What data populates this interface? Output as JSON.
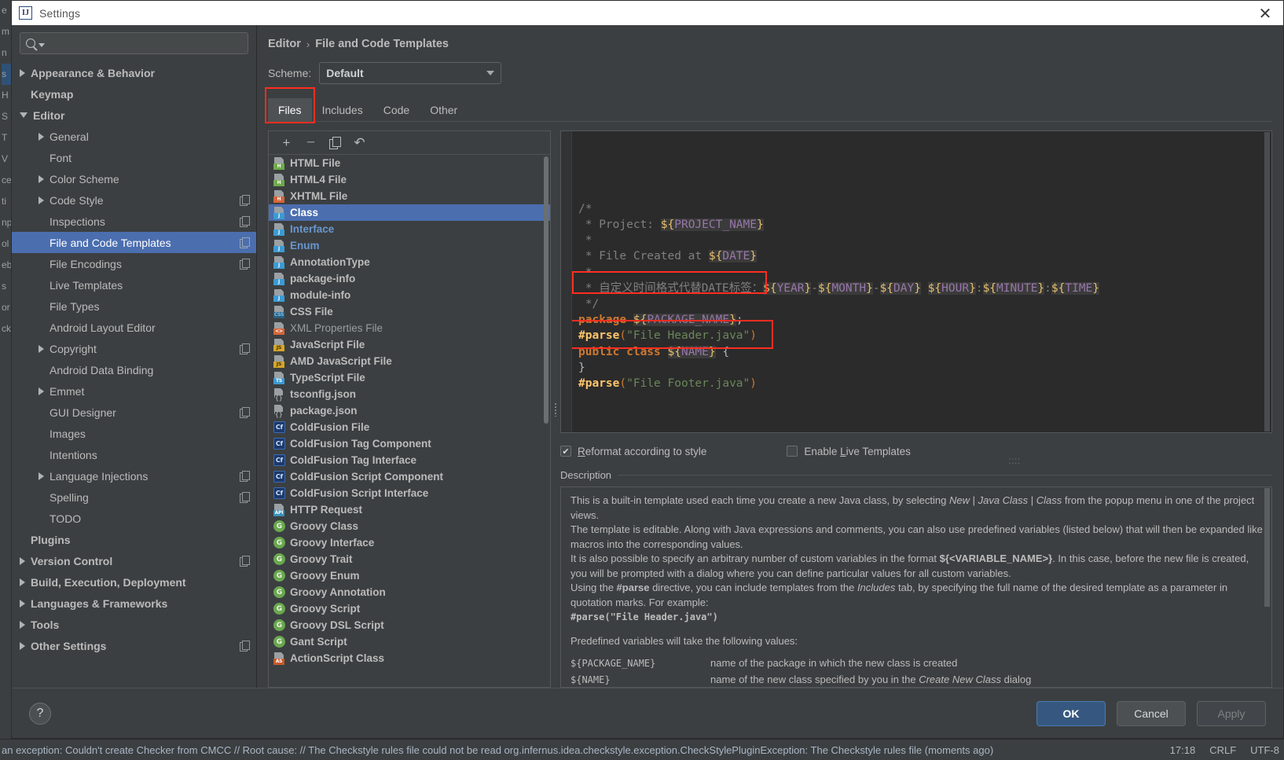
{
  "window": {
    "title": "Settings",
    "logo_text": "IJ",
    "close_label": "✕"
  },
  "search": {
    "value": "",
    "placeholder": ""
  },
  "sidebar": {
    "items": [
      {
        "label": "Appearance & Behavior",
        "arrow": "closed",
        "indent": 0,
        "bold": true,
        "copy": false,
        "selected": false
      },
      {
        "label": "Keymap",
        "arrow": "none",
        "indent": 0,
        "bold": true,
        "copy": false,
        "selected": false
      },
      {
        "label": "Editor",
        "arrow": "open",
        "indent": 0,
        "bold": true,
        "copy": false,
        "selected": false
      },
      {
        "label": "General",
        "arrow": "closed",
        "indent": 1,
        "bold": false,
        "copy": false,
        "selected": false
      },
      {
        "label": "Font",
        "arrow": "none",
        "indent": 1,
        "bold": false,
        "copy": false,
        "selected": false
      },
      {
        "label": "Color Scheme",
        "arrow": "closed",
        "indent": 1,
        "bold": false,
        "copy": false,
        "selected": false
      },
      {
        "label": "Code Style",
        "arrow": "closed",
        "indent": 1,
        "bold": false,
        "copy": true,
        "selected": false
      },
      {
        "label": "Inspections",
        "arrow": "none",
        "indent": 1,
        "bold": false,
        "copy": true,
        "selected": false
      },
      {
        "label": "File and Code Templates",
        "arrow": "none",
        "indent": 1,
        "bold": false,
        "copy": true,
        "selected": true
      },
      {
        "label": "File Encodings",
        "arrow": "none",
        "indent": 1,
        "bold": false,
        "copy": true,
        "selected": false
      },
      {
        "label": "Live Templates",
        "arrow": "none",
        "indent": 1,
        "bold": false,
        "copy": false,
        "selected": false
      },
      {
        "label": "File Types",
        "arrow": "none",
        "indent": 1,
        "bold": false,
        "copy": false,
        "selected": false
      },
      {
        "label": "Android Layout Editor",
        "arrow": "none",
        "indent": 1,
        "bold": false,
        "copy": false,
        "selected": false
      },
      {
        "label": "Copyright",
        "arrow": "closed",
        "indent": 1,
        "bold": false,
        "copy": true,
        "selected": false
      },
      {
        "label": "Android Data Binding",
        "arrow": "none",
        "indent": 1,
        "bold": false,
        "copy": false,
        "selected": false
      },
      {
        "label": "Emmet",
        "arrow": "closed",
        "indent": 1,
        "bold": false,
        "copy": false,
        "selected": false
      },
      {
        "label": "GUI Designer",
        "arrow": "none",
        "indent": 1,
        "bold": false,
        "copy": true,
        "selected": false
      },
      {
        "label": "Images",
        "arrow": "none",
        "indent": 1,
        "bold": false,
        "copy": false,
        "selected": false
      },
      {
        "label": "Intentions",
        "arrow": "none",
        "indent": 1,
        "bold": false,
        "copy": false,
        "selected": false
      },
      {
        "label": "Language Injections",
        "arrow": "closed",
        "indent": 1,
        "bold": false,
        "copy": true,
        "selected": false
      },
      {
        "label": "Spelling",
        "arrow": "none",
        "indent": 1,
        "bold": false,
        "copy": true,
        "selected": false
      },
      {
        "label": "TODO",
        "arrow": "none",
        "indent": 1,
        "bold": false,
        "copy": false,
        "selected": false
      },
      {
        "label": "Plugins",
        "arrow": "none",
        "indent": 0,
        "bold": true,
        "copy": false,
        "selected": false
      },
      {
        "label": "Version Control",
        "arrow": "closed",
        "indent": 0,
        "bold": true,
        "copy": true,
        "selected": false
      },
      {
        "label": "Build, Execution, Deployment",
        "arrow": "closed",
        "indent": 0,
        "bold": true,
        "copy": false,
        "selected": false
      },
      {
        "label": "Languages & Frameworks",
        "arrow": "closed",
        "indent": 0,
        "bold": true,
        "copy": false,
        "selected": false
      },
      {
        "label": "Tools",
        "arrow": "closed",
        "indent": 0,
        "bold": true,
        "copy": false,
        "selected": false
      },
      {
        "label": "Other Settings",
        "arrow": "closed",
        "indent": 0,
        "bold": true,
        "copy": true,
        "selected": false
      }
    ]
  },
  "breadcrumb": {
    "parent": "Editor",
    "separator": "›",
    "current": "File and Code Templates"
  },
  "scheme": {
    "label": "Scheme:",
    "value": "Default"
  },
  "tabs": [
    {
      "label": "Files",
      "active": true
    },
    {
      "label": "Includes",
      "active": false
    },
    {
      "label": "Code",
      "active": false
    },
    {
      "label": "Other",
      "active": false
    }
  ],
  "toolbar": {
    "add_label": "+",
    "remove_label": "−",
    "copy_label": "copy",
    "reset_label": "↶"
  },
  "templates": [
    {
      "name": "HTML File",
      "icon": "file-html",
      "tag": "H",
      "style": "normal",
      "selected": false
    },
    {
      "name": "HTML4 File",
      "icon": "file-html",
      "tag": "H",
      "style": "normal",
      "selected": false
    },
    {
      "name": "XHTML File",
      "icon": "file-xhtml",
      "tag": "H",
      "style": "normal",
      "selected": false
    },
    {
      "name": "Class",
      "icon": "file-java",
      "tag": "J",
      "style": "normal",
      "selected": true
    },
    {
      "name": "Interface",
      "icon": "file-java",
      "tag": "J",
      "style": "blue",
      "selected": false
    },
    {
      "name": "Enum",
      "icon": "file-java",
      "tag": "J",
      "style": "blue",
      "selected": false
    },
    {
      "name": "AnnotationType",
      "icon": "file-java",
      "tag": "J",
      "style": "normal",
      "selected": false
    },
    {
      "name": "package-info",
      "icon": "file-java",
      "tag": "J",
      "style": "normal",
      "selected": false
    },
    {
      "name": "module-info",
      "icon": "file-java",
      "tag": "J",
      "style": "normal",
      "selected": false
    },
    {
      "name": "CSS File",
      "icon": "file-css",
      "tag": "CSS",
      "style": "normal",
      "selected": false
    },
    {
      "name": "XML Properties File",
      "icon": "file-xml",
      "tag": "<>",
      "style": "dim",
      "selected": false
    },
    {
      "name": "JavaScript File",
      "icon": "file-js",
      "tag": "JS",
      "style": "normal",
      "selected": false
    },
    {
      "name": "AMD JavaScript File",
      "icon": "file-js",
      "tag": "JS",
      "style": "normal",
      "selected": false
    },
    {
      "name": "TypeScript File",
      "icon": "file-ts",
      "tag": "TS",
      "style": "normal",
      "selected": false
    },
    {
      "name": "tsconfig.json",
      "icon": "file-json",
      "tag": "{}",
      "style": "normal",
      "selected": false
    },
    {
      "name": "package.json",
      "icon": "file-json",
      "tag": "{}",
      "style": "normal",
      "selected": false
    },
    {
      "name": "ColdFusion File",
      "icon": "badge-cf",
      "tag": "Cf",
      "style": "normal",
      "selected": false
    },
    {
      "name": "ColdFusion Tag Component",
      "icon": "badge-cf",
      "tag": "Cf",
      "style": "normal",
      "selected": false
    },
    {
      "name": "ColdFusion Tag Interface",
      "icon": "badge-cf",
      "tag": "Cf",
      "style": "normal",
      "selected": false
    },
    {
      "name": "ColdFusion Script Component",
      "icon": "badge-cf",
      "tag": "Cf",
      "style": "normal",
      "selected": false
    },
    {
      "name": "ColdFusion Script Interface",
      "icon": "badge-cf",
      "tag": "Cf",
      "style": "normal",
      "selected": false
    },
    {
      "name": "HTTP Request",
      "icon": "file-api",
      "tag": "API",
      "style": "normal",
      "selected": false
    },
    {
      "name": "Groovy Class",
      "icon": "badge-g",
      "tag": "G",
      "style": "normal",
      "selected": false
    },
    {
      "name": "Groovy Interface",
      "icon": "badge-g",
      "tag": "G",
      "style": "normal",
      "selected": false
    },
    {
      "name": "Groovy Trait",
      "icon": "badge-g",
      "tag": "G",
      "style": "normal",
      "selected": false
    },
    {
      "name": "Groovy Enum",
      "icon": "badge-g",
      "tag": "G",
      "style": "normal",
      "selected": false
    },
    {
      "name": "Groovy Annotation",
      "icon": "badge-g",
      "tag": "G",
      "style": "normal",
      "selected": false
    },
    {
      "name": "Groovy Script",
      "icon": "badge-g",
      "tag": "G",
      "style": "normal",
      "selected": false
    },
    {
      "name": "Groovy DSL Script",
      "icon": "badge-g",
      "tag": "G",
      "style": "normal",
      "selected": false
    },
    {
      "name": "Gant Script",
      "icon": "badge-g",
      "tag": "G",
      "style": "normal",
      "selected": false
    },
    {
      "name": "ActionScript Class",
      "icon": "file-as",
      "tag": "AS",
      "style": "normal",
      "selected": false
    }
  ],
  "editor": {
    "lines": [
      "/*",
      " * Project: ${PROJECT_NAME}",
      " *",
      " * File Created at ${DATE}",
      " *",
      " * 自定义时间格式代替DATE标签：${YEAR}-${MONTH}-${DAY} ${HOUR}:${MINUTE}:${TIME}",
      " */",
      "package ${PACKAGE_NAME};",
      "",
      "#parse(\"File Header.java\")",
      "public class ${NAME} {",
      "}",
      "#parse(\"File Footer.java\")"
    ]
  },
  "options": {
    "reformat": {
      "label": "Reformat according to style",
      "checked": true,
      "check_glyph": "✔"
    },
    "live_templates": {
      "label": "Enable Live Templates",
      "checked": false,
      "check_glyph": ""
    }
  },
  "description": {
    "title": "Description",
    "paragraphs": [
      "This is a built-in template used each time you create a new Java class, by selecting New | Java Class | Class from the popup menu in one of the project views.",
      "The template is editable. Along with Java expressions and comments, you can also use predefined variables (listed below) that will then be expanded like macros into the corresponding values.",
      "It is also possible to specify an arbitrary number of custom variables in the format ${<VARIABLE_NAME>}. In this case, before the new file is created, you will be prompted with a dialog where you can define particular values for all custom variables.",
      "Using the #parse directive, you can include templates from the Includes tab, by specifying the full name of the desired template as a parameter in quotation marks. For example:",
      "#parse(\"File Header.java\")",
      "Predefined variables will take the following values:"
    ],
    "variables": [
      {
        "name": "${PACKAGE_NAME}",
        "desc": "name of the package in which the new class is created"
      },
      {
        "name": "${NAME}",
        "desc": "name of the new class specified by you in the Create New Class dialog"
      }
    ]
  },
  "buttons": {
    "help": "?",
    "ok": "OK",
    "cancel": "Cancel",
    "apply": "Apply"
  },
  "statusbar": {
    "message": "an exception: Couldn't create Checker from CMCC // Root cause: // The Checkstyle rules file could not be read org.infernus.idea.checkstyle.exception.CheckStylePluginException: The Checkstyle rules file  (moments ago)",
    "time": "17:18",
    "line_sep": "CRLF",
    "encoding": "UTF-8"
  },
  "background_text": [
    "e",
    "m",
    "n",
    "s",
    "H",
    "S",
    "T",
    "V",
    "ce",
    "ti",
    "np",
    "ol",
    "eb",
    "s",
    "or",
    "ck"
  ],
  "colors": {
    "accent": "#4b6eaf",
    "selection": "#4b6eaf",
    "highlight_box": "#ff2d1f",
    "primary_button": "#365880",
    "panel_bg": "#3c3f41",
    "editor_bg": "#2b2b2b"
  }
}
